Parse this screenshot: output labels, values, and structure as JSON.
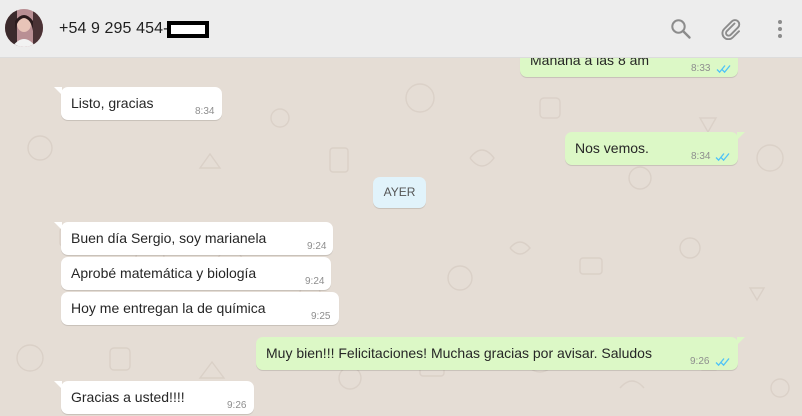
{
  "header": {
    "contact_name": "+54 9 295 454-",
    "icons": [
      "search-icon",
      "paperclip-icon",
      "more-options-icon"
    ]
  },
  "colors": {
    "chat_bg": "#e5ddd5",
    "incoming_bubble": "#ffffff",
    "outgoing_bubble": "#dcf8c6",
    "read_ticks": "#4fc3f7",
    "day_chip": "#e1f3fb"
  },
  "messages": [
    {
      "dir": "out",
      "text": "Mañana a las 8 am",
      "time": "8:33",
      "read": true
    },
    {
      "dir": "in",
      "text": "Listo, gracias",
      "time": "8:34"
    },
    {
      "dir": "out",
      "text": "Nos vemos.",
      "time": "8:34",
      "read": true
    },
    {
      "dir": "in",
      "text": "Buen día Sergio, soy marianela",
      "time": "9:24"
    },
    {
      "dir": "in",
      "text": "Aprobé matemática y biología",
      "time": "9:24"
    },
    {
      "dir": "in",
      "text": "Hoy me entregan la de química",
      "time": "9:25"
    },
    {
      "dir": "out",
      "text": "Muy bien!!! Felicitaciones! Muchas gracias por avisar. Saludos",
      "time": "9:26",
      "read": true
    },
    {
      "dir": "in",
      "text": "Gracias a usted!!!!",
      "time": "9:26"
    }
  ],
  "day_divider": "AYER"
}
